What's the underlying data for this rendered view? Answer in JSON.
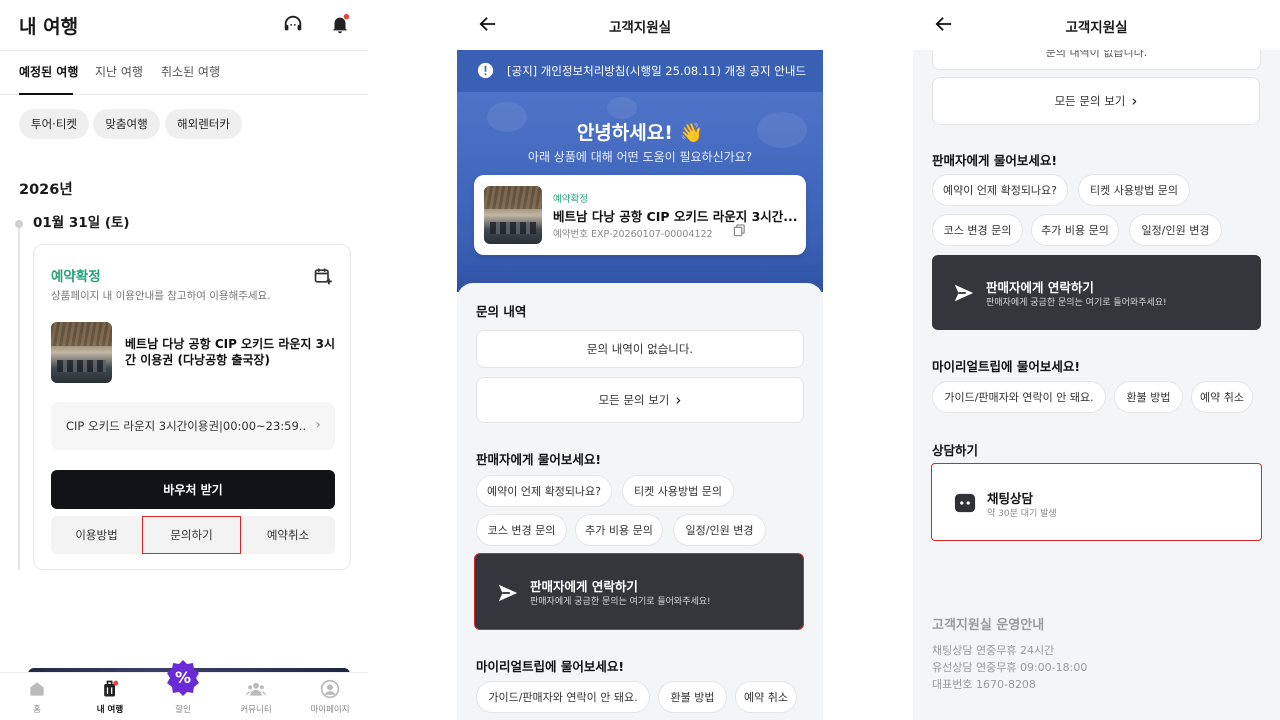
{
  "panel1": {
    "title": "내 여행",
    "tabs": [
      "예정된 여행",
      "지난 여행",
      "취소된 여행"
    ],
    "chips": [
      "투어·티켓",
      "맞춤여행",
      "해외렌터카"
    ],
    "year": "2026년",
    "date": "01월 31일 (토)",
    "card": {
      "status": "예약확정",
      "note": "상품페이지 내 이용안내를 참고하여 이용해주세요.",
      "product_name": "베트남 다낭 공항 CIP 오키드 라운지 3시간 이용권 (다낭공항 출국장)",
      "option": "CIP 오키드 라운지 3시간이용권|00:00~23:59...",
      "voucher_button": "바우처 받기",
      "actions": [
        "이용방법",
        "문의하기",
        "예약취소"
      ]
    },
    "nav": [
      "홈",
      "내 여행",
      "할인",
      "커뮤니티",
      "마이페이지"
    ],
    "colors": {
      "status_green": "#27a17a",
      "highlight_red": "#d6272b",
      "notification_dot": "#e8443a"
    }
  },
  "panel2": {
    "header_title": "고객지원실",
    "notice": "[공지] 개인정보처리방침(시행일 25.08.11) 개정 공지 안내드...",
    "hero_title": "안녕하세요! 👋",
    "hero_sub": "아래 상품에 대해 어떤 도움이 필요하신가요?",
    "booking": {
      "status": "예약확정",
      "name": "베트남 다낭 공항 CIP 오키드 라운지 3시간...",
      "ref": "예약번호 EXP-20260107-00004122"
    },
    "inquiry_title": "문의 내역",
    "no_inquiry": "문의 내역이 없습니다.",
    "view_all": "모든 문의 보기",
    "seller_title": "판매자에게 물어보세요!",
    "seller_questions": [
      "예약이 언제 확정되나요?",
      "티켓 사용방법 문의",
      "코스 변경 문의",
      "추가 비용 문의",
      "일정/인원 변경"
    ],
    "contact_title": "판매자에게 연락하기",
    "contact_sub": "판매자에게 궁금한 문의는 여기로 들어와주세요!",
    "myreal_title": "마이리얼트립에 물어보세요!",
    "myreal_questions": [
      "가이드/판매자와 연락이 안 돼요.",
      "환불 방법",
      "예약 취소"
    ],
    "colors": {
      "notice_blue": "#3a60b5",
      "hero_blue": "#4f73c6",
      "contact_dark": "#34363c"
    }
  },
  "panel3": {
    "header_title": "고객지원실",
    "clipped_text": "문의 내역이 없습니다.",
    "view_all": "모든 문의 보기",
    "seller_title": "판매자에게 물어보세요!",
    "seller_questions": [
      "예약이 언제 확정되나요?",
      "티켓 사용방법 문의",
      "코스 변경 문의",
      "추가 비용 문의",
      "일정/인원 변경"
    ],
    "contact_title": "판매자에게 연락하기",
    "contact_sub": "판매자에게 궁금한 문의는 여기로 들어와주세요!",
    "myreal_title": "마이리얼트립에 물어보세요!",
    "myreal_questions": [
      "가이드/판매자와 연락이 안 돼요.",
      "환불 방법",
      "예약 취소"
    ],
    "consult_title": "상담하기",
    "chat_title": "채팅상담",
    "chat_sub": "약 30분 대기 발생",
    "ops_title": "고객지원실 운영안내",
    "ops_lines": [
      "채팅상담 연중무휴 24시간",
      "유선상담 연중무휴 09:00-18:00",
      "대표번호 1670-8208"
    ]
  }
}
